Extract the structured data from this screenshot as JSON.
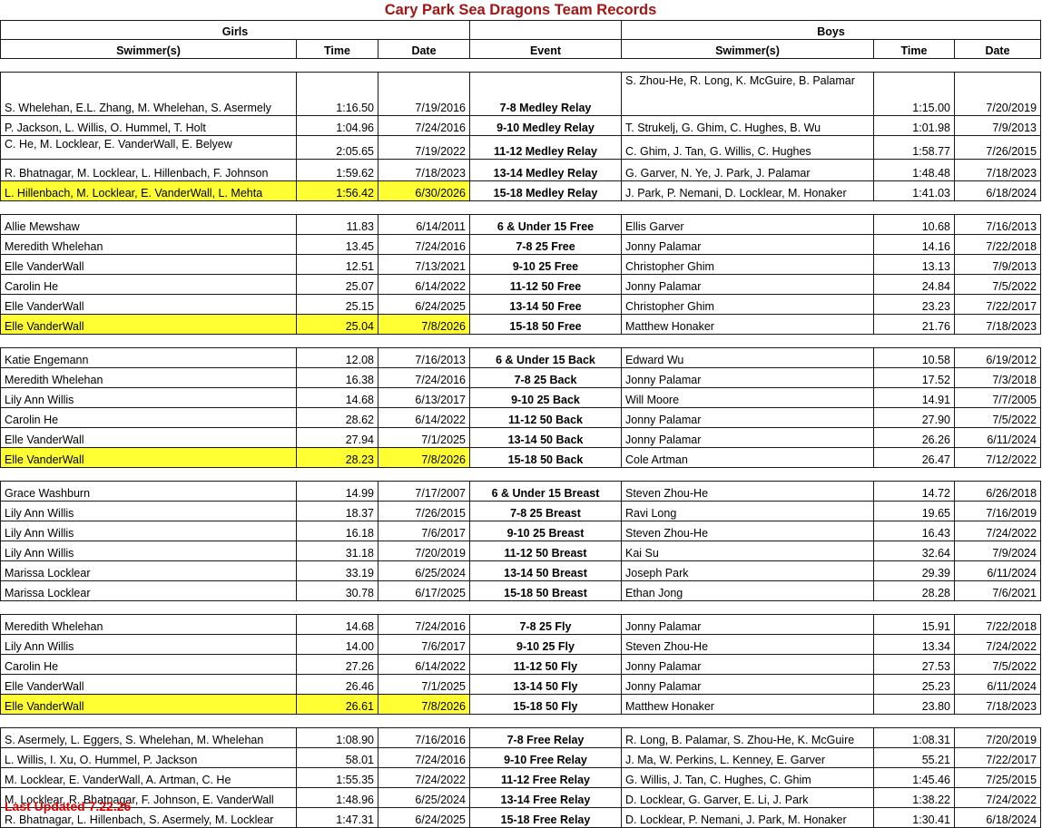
{
  "title": "Cary Park Sea Dragons Team Records",
  "headers": {
    "girls": "Girls",
    "boys": "Boys",
    "swimmers": "Swimmer(s)",
    "time": "Time",
    "date": "Date",
    "event": "Event"
  },
  "highlight_color": "#ffff33",
  "title_color": "#a31515",
  "footer": "Last Updated 7.22.26",
  "sections": [
    [
      {
        "gs": "S. Whelehan, E.L. Zhang, M. Whelehan, S. Asermely",
        "gt": "1:16.50",
        "gd": "7/19/2016",
        "ev": "7-8 Medley Relay",
        "bs": "S. Zhou-He, R. Long, K. McGuire, B. Palamar",
        "bt": "1:15.00",
        "bd": "7/20/2019",
        "hl": false
      },
      {
        "gs": "P. Jackson, L. Willis, O. Hummel, T. Holt",
        "gt": "1:04.96",
        "gd": "7/24/2016",
        "ev": "9-10 Medley Relay",
        "bs": "T. Strukelj, G. Ghim, C. Hughes, B. Wu",
        "bt": "1:01.98",
        "bd": "7/9/2013",
        "hl": false
      },
      {
        "gs": "C. He, M. Locklear, E. VanderWall, E. Belyew",
        "gt": "2:05.65",
        "gd": "7/19/2022",
        "ev": "11-12 Medley Relay",
        "bs": "C. Ghim, J. Tan, G. Willis, C. Hughes",
        "bt": "1:58.77",
        "bd": "7/26/2015",
        "hl": false
      },
      {
        "gs": "R. Bhatnagar, M. Locklear, L. Hillenbach, F. Johnson",
        "gt": "1:59.62",
        "gd": "7/18/2023",
        "ev": "13-14 Medley Relay",
        "bs": "G. Garver, N. Ye, J. Park, J. Palamar",
        "bt": "1:48.48",
        "bd": "7/18/2023",
        "hl": false
      },
      {
        "gs": "L. Hillenbach, M. Locklear, E. VanderWall, L. Mehta",
        "gt": "1:56.42",
        "gd": "6/30/2026",
        "ev": "15-18 Medley Relay",
        "bs": "J. Park, P. Nemani, D. Locklear, M. Honaker",
        "bt": "1:41.03",
        "bd": "6/18/2024",
        "hl": true
      }
    ],
    [
      {
        "gs": "Allie Mewshaw",
        "gt": "11.83",
        "gd": "6/14/2011",
        "ev": "6 & Under 15 Free",
        "bs": "Ellis Garver",
        "bt": "10.68",
        "bd": "7/16/2013",
        "hl": false
      },
      {
        "gs": "Meredith Whelehan",
        "gt": "13.45",
        "gd": "7/24/2016",
        "ev": "7-8 25 Free",
        "bs": "Jonny Palamar",
        "bt": "14.16",
        "bd": "7/22/2018",
        "hl": false
      },
      {
        "gs": "Elle VanderWall",
        "gt": "12.51",
        "gd": "7/13/2021",
        "ev": "9-10 25 Free",
        "bs": "Christopher Ghim",
        "bt": "13.13",
        "bd": "7/9/2013",
        "hl": false
      },
      {
        "gs": "Carolin He",
        "gt": "25.07",
        "gd": "6/14/2022",
        "ev": "11-12 50 Free",
        "bs": "Jonny Palamar",
        "bt": "24.84",
        "bd": "7/5/2022",
        "hl": false
      },
      {
        "gs": "Elle VanderWall",
        "gt": "25.15",
        "gd": "6/24/2025",
        "ev": "13-14 50 Free",
        "bs": "Christopher Ghim",
        "bt": "23.23",
        "bd": "7/22/2017",
        "hl": false
      },
      {
        "gs": "Elle VanderWall",
        "gt": "25.04",
        "gd": "7/8/2026",
        "ev": "15-18 50 Free",
        "bs": "Matthew Honaker",
        "bt": "21.76",
        "bd": "7/18/2023",
        "hl": true
      }
    ],
    [
      {
        "gs": "Katie Engemann",
        "gt": "12.08",
        "gd": "7/16/2013",
        "ev": "6 & Under 15 Back",
        "bs": "Edward Wu",
        "bt": "10.58",
        "bd": "6/19/2012",
        "hl": false
      },
      {
        "gs": "Meredith Whelehan",
        "gt": "16.38",
        "gd": "7/24/2016",
        "ev": "7-8 25 Back",
        "bs": "Jonny Palamar",
        "bt": "17.52",
        "bd": "7/3/2018",
        "hl": false
      },
      {
        "gs": "Lily Ann Willis",
        "gt": "14.68",
        "gd": "6/13/2017",
        "ev": "9-10 25 Back",
        "bs": "Will Moore",
        "bt": "14.91",
        "bd": "7/7/2005",
        "hl": false
      },
      {
        "gs": "Carolin He",
        "gt": "28.62",
        "gd": "6/14/2022",
        "ev": "11-12 50 Back",
        "bs": "Jonny Palamar",
        "bt": "27.90",
        "bd": "7/5/2022",
        "hl": false
      },
      {
        "gs": "Elle VanderWall",
        "gt": "27.94",
        "gd": "7/1/2025",
        "ev": "13-14 50 Back",
        "bs": "Jonny Palamar",
        "bt": "26.26",
        "bd": "6/11/2024",
        "hl": false
      },
      {
        "gs": "Elle VanderWall",
        "gt": "28.23",
        "gd": "7/8/2026",
        "ev": "15-18 50 Back",
        "bs": "Cole Artman",
        "bt": "26.47",
        "bd": "7/12/2022",
        "hl": true
      }
    ],
    [
      {
        "gs": "Grace Washburn",
        "gt": "14.99",
        "gd": "7/17/2007",
        "ev": "6 & Under 15 Breast",
        "bs": "Steven Zhou-He",
        "bt": "14.72",
        "bd": "6/26/2018",
        "hl": false
      },
      {
        "gs": "Lily Ann Willis",
        "gt": "18.37",
        "gd": "7/26/2015",
        "ev": "7-8 25 Breast",
        "bs": "Ravi Long",
        "bt": "19.65",
        "bd": "7/16/2019",
        "hl": false
      },
      {
        "gs": "Lily Ann Willis",
        "gt": "16.18",
        "gd": "7/6/2017",
        "ev": "9-10 25 Breast",
        "bs": "Steven Zhou-He",
        "bt": "16.43",
        "bd": "7/24/2022",
        "hl": false
      },
      {
        "gs": "Lily Ann Willis",
        "gt": "31.18",
        "gd": "7/20/2019",
        "ev": "11-12 50 Breast",
        "bs": "Kai Su",
        "bt": "32.64",
        "bd": "7/9/2024",
        "hl": false
      },
      {
        "gs": "Marissa Locklear",
        "gt": "33.19",
        "gd": "6/25/2024",
        "ev": "13-14 50 Breast",
        "bs": "Joseph Park",
        "bt": "29.39",
        "bd": "6/11/2024",
        "hl": false
      },
      {
        "gs": "Marissa Locklear",
        "gt": "30.78",
        "gd": "6/17/2025",
        "ev": "15-18 50 Breast",
        "bs": "Ethan Jong",
        "bt": "28.28",
        "bd": "7/6/2021",
        "hl": false
      }
    ],
    [
      {
        "gs": "Meredith Whelehan",
        "gt": "14.68",
        "gd": "7/24/2016",
        "ev": "7-8 25 Fly",
        "bs": "Jonny Palamar",
        "bt": "15.91",
        "bd": "7/22/2018",
        "hl": false
      },
      {
        "gs": "Lily Ann Willis",
        "gt": "14.00",
        "gd": "7/6/2017",
        "ev": "9-10 25 Fly",
        "bs": "Steven Zhou-He",
        "bt": "13.34",
        "bd": "7/24/2022",
        "hl": false
      },
      {
        "gs": "Carolin He",
        "gt": "27.26",
        "gd": "6/14/2022",
        "ev": "11-12 50 Fly",
        "bs": "Jonny Palamar",
        "bt": "27.53",
        "bd": "7/5/2022",
        "hl": false
      },
      {
        "gs": "Elle VanderWall",
        "gt": "26.46",
        "gd": "7/1/2025",
        "ev": "13-14 50 Fly",
        "bs": "Jonny Palamar",
        "bt": "25.23",
        "bd": "6/11/2024",
        "hl": false
      },
      {
        "gs": "Elle VanderWall",
        "gt": "26.61",
        "gd": "7/8/2026",
        "ev": "15-18 50 Fly",
        "bs": "Matthew Honaker",
        "bt": "23.80",
        "bd": "7/18/2023",
        "hl": true
      }
    ],
    [
      {
        "gs": "S. Asermely, L. Eggers, S. Whelehan, M. Whelehan",
        "gt": "1:08.90",
        "gd": "7/16/2016",
        "ev": "7-8 Free Relay",
        "bs": "R. Long, B. Palamar, S. Zhou-He, K. McGuire",
        "bt": "1:08.31",
        "bd": "7/20/2019",
        "hl": false
      },
      {
        "gs": "L. Willis, I. Xu, O. Hummel, P. Jackson",
        "gt": "58.01",
        "gd": "7/24/2016",
        "ev": "9-10 Free Relay",
        "bs": "J. Ma, W. Perkins, L. Kenney, E. Garver",
        "bt": "55.21",
        "bd": "7/22/2017",
        "hl": false
      },
      {
        "gs": "M. Locklear, E. VanderWall, A. Artman, C. He",
        "gt": "1:55.35",
        "gd": "7/24/2022",
        "ev": "11-12 Free Relay",
        "bs": "G. Willis, J. Tan, C. Hughes, C. Ghim",
        "bt": "1:45.46",
        "bd": "7/25/2015",
        "hl": false
      },
      {
        "gs": "M. Locklear, R. Bhatnagar, F. Johnson, E. VanderWall",
        "gt": "1:48.96",
        "gd": "6/25/2024",
        "ev": "13-14 Free Relay",
        "bs": "D. Locklear, G. Garver, E. Li, J. Park",
        "bt": "1:38.22",
        "bd": "7/24/2022",
        "hl": false
      },
      {
        "gs": "R. Bhatnagar, L. Hillenbach, S. Asermely, M. Locklear",
        "gt": "1:47.31",
        "gd": "6/24/2025",
        "ev": "15-18 Free Relay",
        "bs": "D. Locklear, P. Nemani, J. Park, M. Honaker",
        "bt": "1:30.41",
        "bd": "6/18/2024",
        "hl": false
      }
    ]
  ]
}
